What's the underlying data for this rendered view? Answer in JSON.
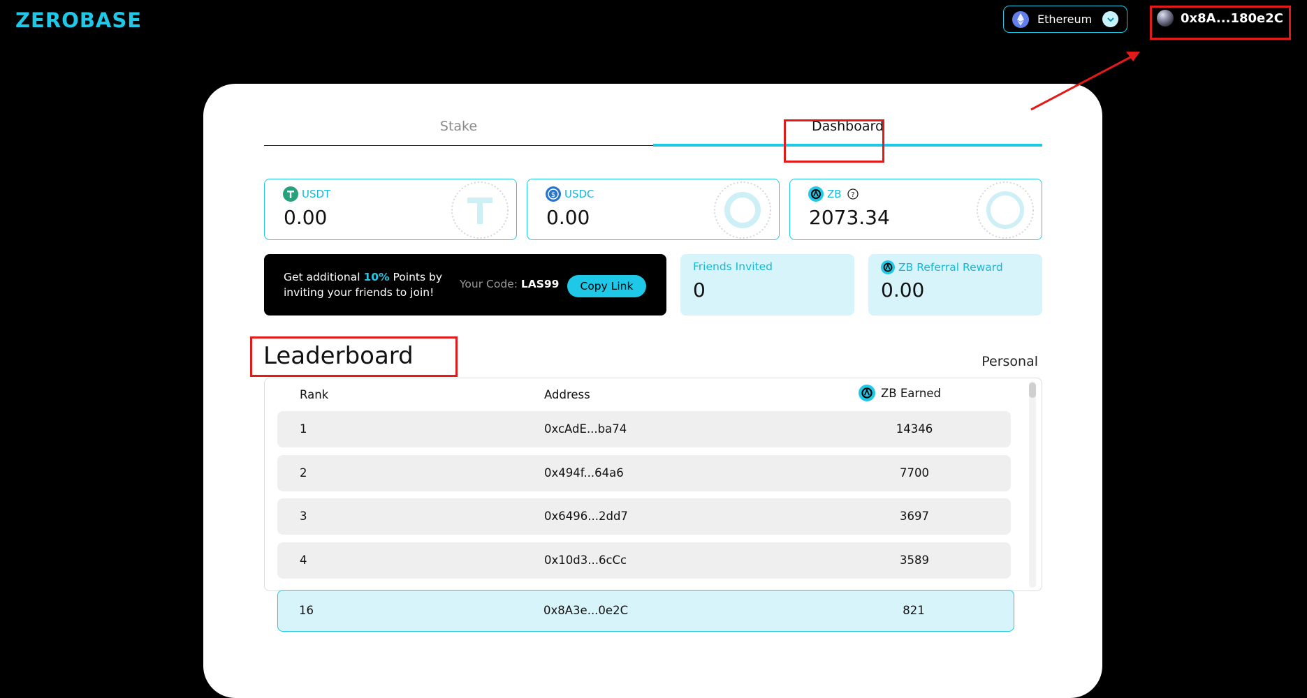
{
  "brand": {
    "logo": "ZEROBASE",
    "accent": "#1ec8e6"
  },
  "header": {
    "network": {
      "label": "Ethereum",
      "icon": "ethereum-icon"
    },
    "wallet": {
      "address": "0x8A...180e2C"
    }
  },
  "tabs": [
    {
      "label": "Stake",
      "active": false
    },
    {
      "label": "Dashboard",
      "active": true
    }
  ],
  "tokens": [
    {
      "name": "USDT",
      "value": "0.00",
      "icon": "tether-icon"
    },
    {
      "name": "USDC",
      "value": "0.00",
      "icon": "usdc-icon"
    },
    {
      "name": "ZB",
      "value": "2073.34",
      "icon": "zerobase-icon"
    }
  ],
  "referral": {
    "text_prefix": "Get additional ",
    "highlight": "10%",
    "text_suffix": " Points by inviting your friends to join!",
    "code_label": "Your Code:",
    "code": "LAS99",
    "copy_label": "Copy Link"
  },
  "stats": {
    "friends_invited": {
      "label": "Friends Invited",
      "value": "0"
    },
    "referral_reward": {
      "token": "ZB",
      "label": "Referral Reward",
      "value": "0.00"
    }
  },
  "leaderboard": {
    "title": "Leaderboard",
    "filter_label": "Personal",
    "columns": {
      "rank": "Rank",
      "address": "Address",
      "earned": "ZB Earned"
    },
    "rows": [
      {
        "rank": "1",
        "address": "0xcAdE...ba74",
        "earned": "14346"
      },
      {
        "rank": "2",
        "address": "0x494f...64a6",
        "earned": "7700"
      },
      {
        "rank": "3",
        "address": "0x6496...2dd7",
        "earned": "3697"
      },
      {
        "rank": "4",
        "address": "0x10d3...6cCc",
        "earned": "3589"
      }
    ],
    "me": {
      "rank": "16",
      "address": "0x8A3e...0e2C",
      "earned": "821"
    }
  }
}
